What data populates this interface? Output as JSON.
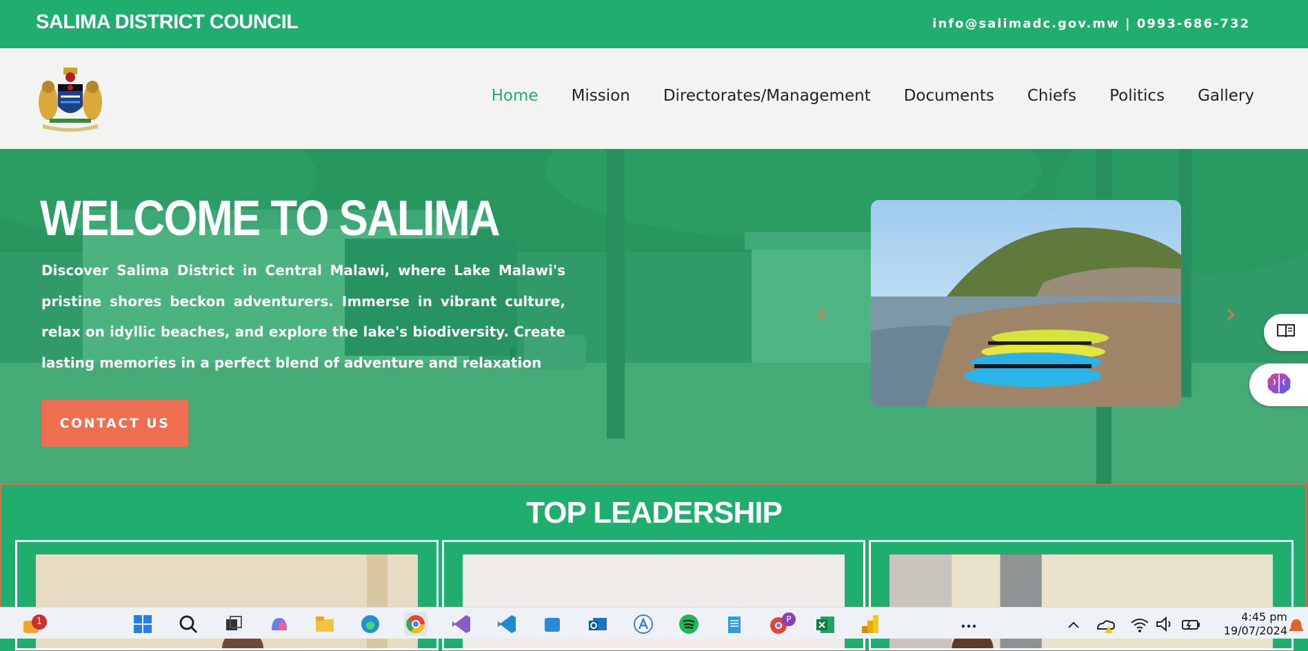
{
  "topbar": {
    "brand": "SALIMA DISTRICT COUNCIL",
    "contact": "info@salimadc.gov.mw | 0993-686-732"
  },
  "nav": {
    "items": [
      {
        "label": "Home",
        "active": true
      },
      {
        "label": "Mission"
      },
      {
        "label": "Directorates/Management"
      },
      {
        "label": "Documents"
      },
      {
        "label": "Chiefs"
      },
      {
        "label": "Politics"
      },
      {
        "label": "Gallery"
      }
    ]
  },
  "hero": {
    "title": "WELCOME TO SALIMA",
    "description": "Discover Salima District in Central Malawi, where Lake Malawi's pristine shores beckon adventurers. Immerse in vibrant culture, relax on idyllic beaches, and explore the lake's biodiversity. Create lasting memories in a perfect blend of adventure and relaxation",
    "cta_label": "CONTACT US",
    "prev_arrow": "‹",
    "next_arrow": "›"
  },
  "leadership": {
    "title": "TOP LEADERSHIP"
  },
  "taskbar": {
    "notification_badge": "1",
    "profile_badge": "P",
    "time": "4:45 pm",
    "date": "19/07/2024"
  },
  "colors": {
    "brand_green": "#1fae6e",
    "accent_orange": "#ee6e50",
    "nav_background": "#f3f4f2"
  },
  "icons": [
    "coat-of-arms-logo",
    "chevron-left-icon",
    "chevron-right-icon",
    "reader-mode-icon",
    "brain-icon"
  ]
}
